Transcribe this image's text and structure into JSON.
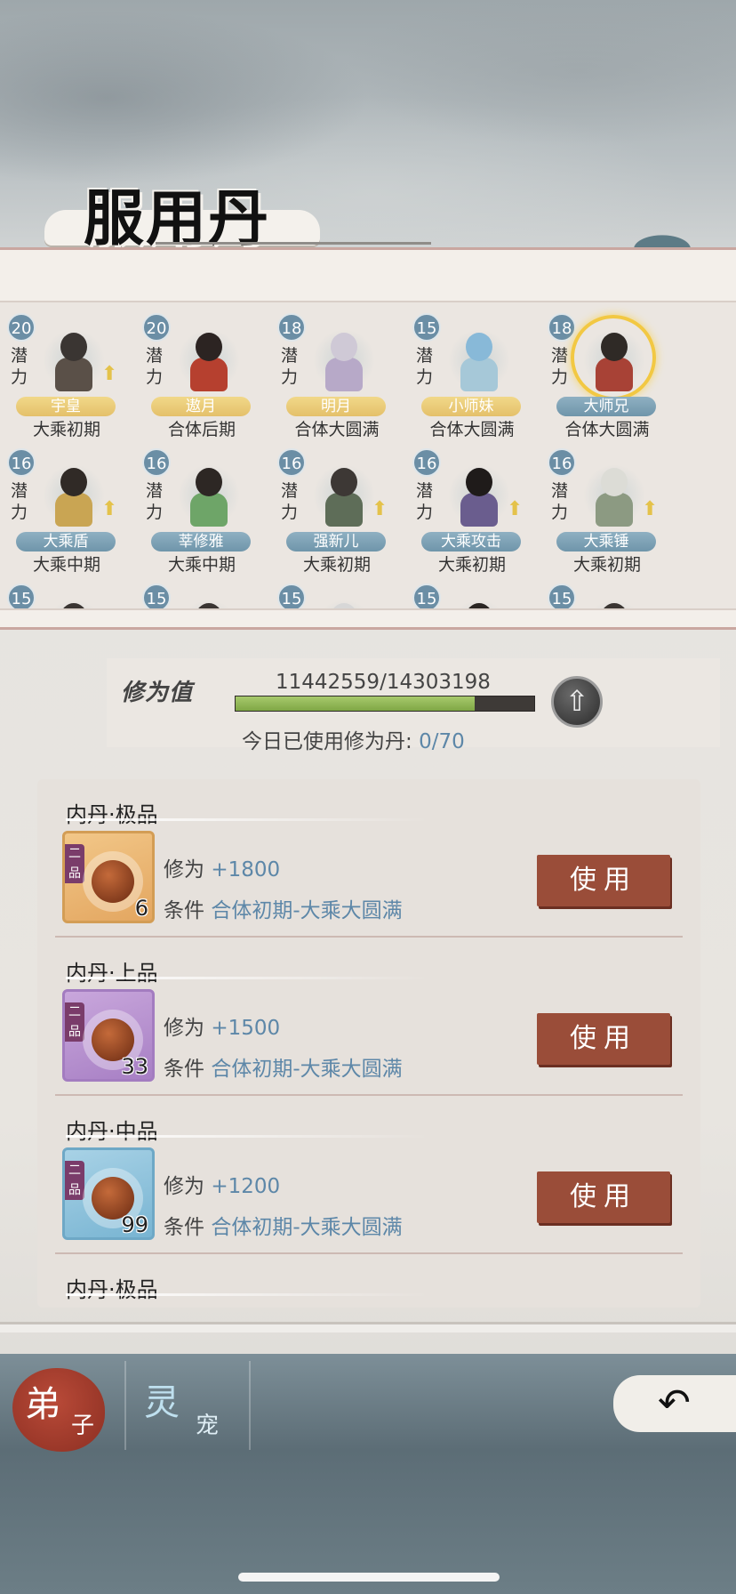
{
  "title": "服用丹药",
  "potential_label": "潜力",
  "disciples": [
    {
      "potential": "20",
      "name": "宇皇",
      "realm": "大乘初期",
      "plate": "gold",
      "promo": true,
      "selected": false,
      "head": "#3a3532",
      "body": "#5a5048"
    },
    {
      "potential": "20",
      "name": "遨月",
      "realm": "合体后期",
      "plate": "gold",
      "promo": false,
      "selected": false,
      "head": "#2c2422",
      "body": "#b6402f"
    },
    {
      "potential": "18",
      "name": "明月",
      "realm": "合体大圆满",
      "plate": "gold",
      "promo": false,
      "selected": false,
      "head": "#cfc9d6",
      "body": "#b7a9c8"
    },
    {
      "potential": "15",
      "name": "小师妹",
      "realm": "合体大圆满",
      "plate": "gold",
      "promo": false,
      "selected": false,
      "head": "#88b9d8",
      "body": "#a6c8d8"
    },
    {
      "potential": "18",
      "name": "大师兄",
      "realm": "合体大圆满",
      "plate": "blue",
      "promo": false,
      "selected": true,
      "head": "#2f2a26",
      "body": "#a84236"
    },
    {
      "potential": "16",
      "name": "大乘盾",
      "realm": "大乘中期",
      "plate": "blue",
      "promo": true,
      "selected": false,
      "head": "#302a26",
      "body": "#c9a553"
    },
    {
      "potential": "16",
      "name": "莘修雅",
      "realm": "大乘中期",
      "plate": "blue",
      "promo": false,
      "selected": false,
      "head": "#2d2724",
      "body": "#6ea568"
    },
    {
      "potential": "16",
      "name": "强新儿",
      "realm": "大乘初期",
      "plate": "blue",
      "promo": true,
      "selected": false,
      "head": "#3d3835",
      "body": "#5e6d58"
    },
    {
      "potential": "16",
      "name": "大乘攻击",
      "realm": "大乘初期",
      "plate": "blue",
      "promo": true,
      "selected": false,
      "head": "#1f1b1a",
      "body": "#6a5d8e"
    },
    {
      "potential": "16",
      "name": "大乘锤",
      "realm": "大乘初期",
      "plate": "blue",
      "promo": true,
      "selected": false,
      "head": "#dcdcd6",
      "body": "#8c9a82"
    },
    {
      "potential": "15",
      "name": "",
      "realm": "",
      "plate": "none",
      "promo": false,
      "selected": false,
      "head": "#3a3532",
      "body": "#5a5048"
    },
    {
      "potential": "15",
      "name": "",
      "realm": "",
      "plate": "none",
      "promo": false,
      "selected": false,
      "head": "#3a3532",
      "body": "#5a5048"
    },
    {
      "potential": "15",
      "name": "",
      "realm": "",
      "plate": "none",
      "promo": false,
      "selected": false,
      "head": "#d7d7d7",
      "body": "#bbbbbb"
    },
    {
      "potential": "15",
      "name": "",
      "realm": "",
      "plate": "none",
      "promo": false,
      "selected": false,
      "head": "#2a2522",
      "body": "#5a5048"
    },
    {
      "potential": "15",
      "name": "",
      "realm": "",
      "plate": "none",
      "promo": false,
      "selected": false,
      "head": "#3a3532",
      "body": "#5a5048"
    }
  ],
  "cultivation": {
    "label": "修为值",
    "current": "11442559",
    "max": "14303198",
    "value_text": "11442559/14303198",
    "progress": 0.8,
    "used_today_label": "今日已使用修为丹:",
    "used_today_value": "0/70"
  },
  "pills": [
    {
      "title": "内丹·极品",
      "grade": "二品",
      "count": "6",
      "stat_label": "修为",
      "stat_value": "+1800",
      "cond_label": "条件",
      "cond_value": "合体初期-大乘大圆满",
      "button": "使用",
      "color": "orange"
    },
    {
      "title": "内丹·上品",
      "grade": "二品",
      "count": "33",
      "stat_label": "修为",
      "stat_value": "+1500",
      "cond_label": "条件",
      "cond_value": "合体初期-大乘大圆满",
      "button": "使用",
      "color": "purple"
    },
    {
      "title": "内丹·中品",
      "grade": "二品",
      "count": "99",
      "stat_label": "修为",
      "stat_value": "+1200",
      "cond_label": "条件",
      "cond_value": "合体初期-大乘大圆满",
      "button": "使用",
      "color": "blue"
    },
    {
      "title": "内丹·极品",
      "grade": "",
      "count": "",
      "stat_label": "",
      "stat_value": "",
      "cond_label": "",
      "cond_value": "",
      "button": "",
      "color": "orange"
    }
  ],
  "tabs": {
    "disciple_main": "弟",
    "disciple_sub": "子",
    "pet_main": "灵",
    "pet_sub": "宠"
  },
  "icons": {
    "upgrade": "arrow-up-icon",
    "back": "back-arrow-icon",
    "promo": "promote-icon"
  }
}
